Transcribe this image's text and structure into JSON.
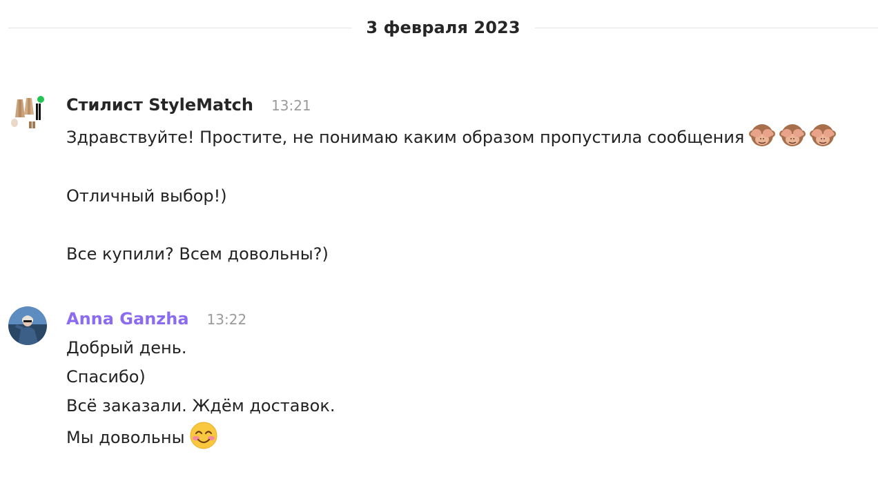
{
  "date_divider": "3 февраля 2023",
  "messages": [
    {
      "author": "Стилист StyleMatch",
      "time": "13:21",
      "online": true,
      "lines": [
        "Здравствуйте! Простите, не понимаю каким образом пропустила сообщения",
        "Отличный выбор!)",
        "Все купили? Всем довольны?)"
      ],
      "emoji_after_line_1": [
        "see-no-evil-monkey",
        "see-no-evil-monkey",
        "see-no-evil-monkey"
      ]
    },
    {
      "author": "Anna Ganzha",
      "author_color": "#8b6cf0",
      "time": "13:22",
      "lines": [
        "Добрый день.",
        "Спасибо)",
        "Всё заказали. Ждём доставок.",
        "Мы довольны"
      ],
      "emoji_after_line_4": [
        "smiling-face-with-smiling-eyes"
      ]
    }
  ]
}
